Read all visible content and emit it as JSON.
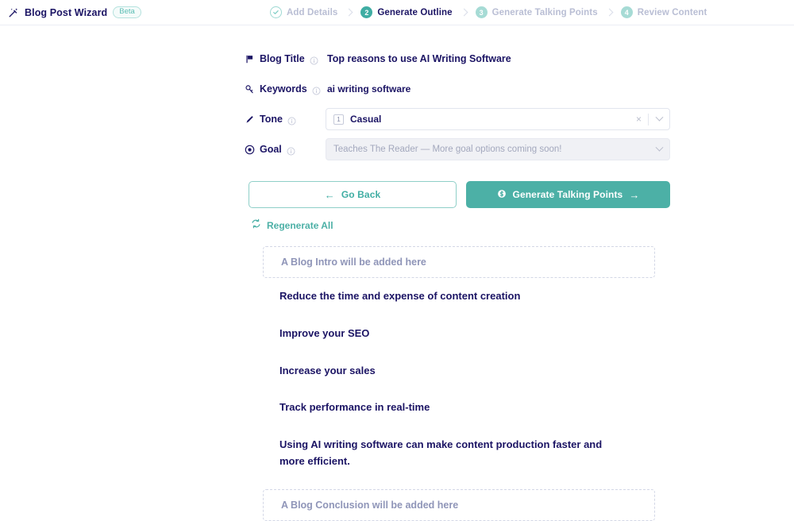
{
  "app": {
    "title": "Blog Post Wizard",
    "badge": "Beta",
    "logo_icon": "magic-wand-icon"
  },
  "steps": [
    {
      "num": "1",
      "label": "Add Details",
      "state": "done",
      "icon": "check-circle-icon"
    },
    {
      "num": "2",
      "label": "Generate Outline",
      "state": "active"
    },
    {
      "num": "3",
      "label": "Generate Talking Points",
      "state": "pending"
    },
    {
      "num": "4",
      "label": "Review Content",
      "state": "pending"
    }
  ],
  "form": {
    "blog_title": {
      "label": "Blog Title",
      "icon": "flag-icon",
      "info_icon": "info-icon",
      "value": "Top reasons to use AI Writing Software"
    },
    "keywords": {
      "label": "Keywords",
      "icon": "key-icon",
      "info_icon": "info-icon",
      "value": "ai writing software"
    },
    "tone": {
      "label": "Tone",
      "icon": "pencil-icon",
      "info_icon": "info-icon",
      "tag_number": "1",
      "value": "Casual",
      "clear_glyph": "×",
      "clear_icon": "clear-selection-icon",
      "dropdown_icon": "chevron-down-icon"
    },
    "goal": {
      "label": "Goal",
      "icon": "target-icon",
      "info_icon": "info-icon",
      "placeholder": "Teaches The Reader — More goal options coming soon!",
      "dropdown_icon": "chevron-down-icon",
      "disabled": true
    }
  },
  "actions": {
    "back": {
      "label": "Go Back",
      "arrow": "←",
      "icon": "arrow-left-icon"
    },
    "primary": {
      "label": "Generate Talking Points",
      "arrow": "→",
      "icon": "credit-coin-icon"
    },
    "regenerate": {
      "label": "Regenerate All",
      "icon": "refresh-icon"
    }
  },
  "outline": {
    "intro_placeholder": "A Blog Intro will be added here",
    "items": [
      "Reduce the time and expense of content creation",
      "Improve your SEO",
      "Increase your sales",
      "Track performance in real-time",
      "Using AI writing software can make content production faster and more efficient."
    ],
    "conclusion_placeholder": "A Blog Conclusion will be added here"
  },
  "colors": {
    "accent_teal": "#4cb0a6",
    "accent_teal_light": "#a6dbd5",
    "navy": "#1b1464",
    "muted": "#8f95b8",
    "border": "#e2e5ee"
  }
}
